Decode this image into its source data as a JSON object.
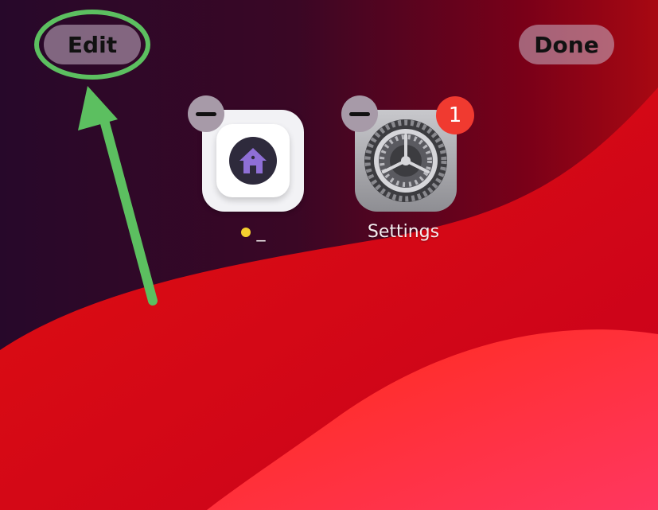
{
  "toolbar": {
    "edit_label": "Edit",
    "done_label": "Done"
  },
  "apps": [
    {
      "name": "_",
      "icon": "home-app-icon",
      "update_dot_color": "#f4cf2f"
    },
    {
      "name": "Settings",
      "icon": "settings-gear-icon",
      "badge": "1"
    }
  ],
  "annotation": {
    "color": "#5cbf60",
    "shapes": [
      "highlight-ellipse",
      "pointer-arrow"
    ]
  },
  "colors": {
    "badge": "#f03a30",
    "pill": "#c8b4c8",
    "house": "#8f6fd6"
  }
}
